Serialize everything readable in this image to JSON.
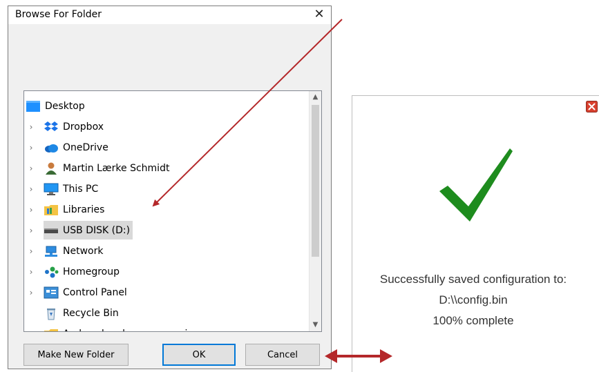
{
  "dialog": {
    "title": "Browse For Folder",
    "close_symbol": "✕",
    "tree_items": [
      {
        "label": "Desktop",
        "icon": "desktop-icon",
        "expandable": false
      },
      {
        "label": "Dropbox",
        "icon": "dropbox-icon",
        "expandable": true
      },
      {
        "label": "OneDrive",
        "icon": "onedrive-icon",
        "expandable": true
      },
      {
        "label": "Martin Lærke Schmidt",
        "icon": "user-icon",
        "expandable": true
      },
      {
        "label": "This PC",
        "icon": "this-pc-icon",
        "expandable": true
      },
      {
        "label": "Libraries",
        "icon": "libraries-icon",
        "expandable": true
      },
      {
        "label": "USB DISK (D:)",
        "icon": "usb-drive-icon",
        "expandable": true,
        "selected": true
      },
      {
        "label": "Network",
        "icon": "network-icon",
        "expandable": true
      },
      {
        "label": "Homegroup",
        "icon": "homegroup-icon",
        "expandable": true
      },
      {
        "label": "Control Panel",
        "icon": "control-panel-icon",
        "expandable": true
      },
      {
        "label": "Recycle Bin",
        "icon": "recycle-bin-icon",
        "expandable": false
      },
      {
        "label": "Amber dongle programming",
        "icon": "folder-icon",
        "expandable": true
      }
    ],
    "buttons": {
      "make_new_folder": "Make New Folder",
      "ok": "OK",
      "cancel": "Cancel"
    }
  },
  "success_panel": {
    "line1": "Successfully saved configuration to:",
    "line2": "D:\\\\config.bin",
    "line3": "100% complete"
  },
  "colors": {
    "arrow": "#b4282a",
    "checkmark": "#1e8c1e",
    "selection": "#d9d9d9",
    "default_button_border": "#0078d7"
  }
}
